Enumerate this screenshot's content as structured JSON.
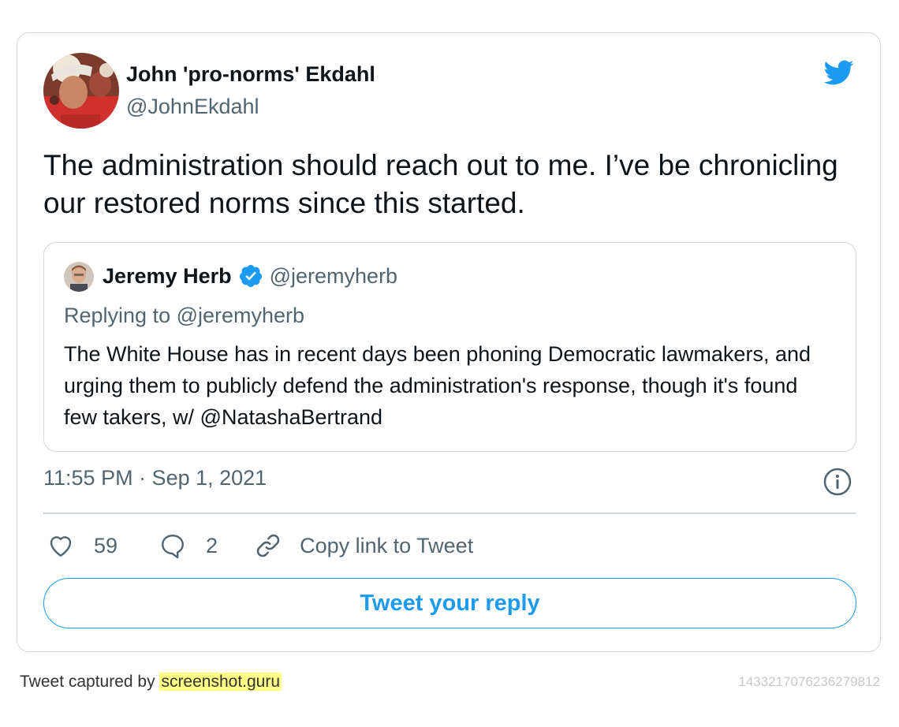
{
  "tweet": {
    "author_name": "John 'pro-norms' Ekdahl",
    "author_handle": "@JohnEkdahl",
    "text": "The administration should reach out to me. I’ve be chronicling our restored norms since this started.",
    "timestamp": "11:55 PM · Sep 1, 2021",
    "brand_icon": "twitter-bird-icon",
    "accent_color": "#1d9bf0"
  },
  "quoted": {
    "author_name": "Jeremy Herb",
    "author_handle": "@jeremyherb",
    "verified": true,
    "replying_to": "Replying to @jeremyherb",
    "text": "The White House has in recent days been phoning Democratic lawmakers, and urging them to publicly defend the administration's response, though it's found few takers, w/ @NatashaBertrand"
  },
  "actions": {
    "like_count": "59",
    "reply_count": "2",
    "copy_link_label": "Copy link to Tweet"
  },
  "reply_button_label": "Tweet your reply",
  "footer": {
    "captured_by": "Tweet captured by ",
    "site": "screenshot.guru",
    "tweet_id": "1433217076236279812"
  }
}
